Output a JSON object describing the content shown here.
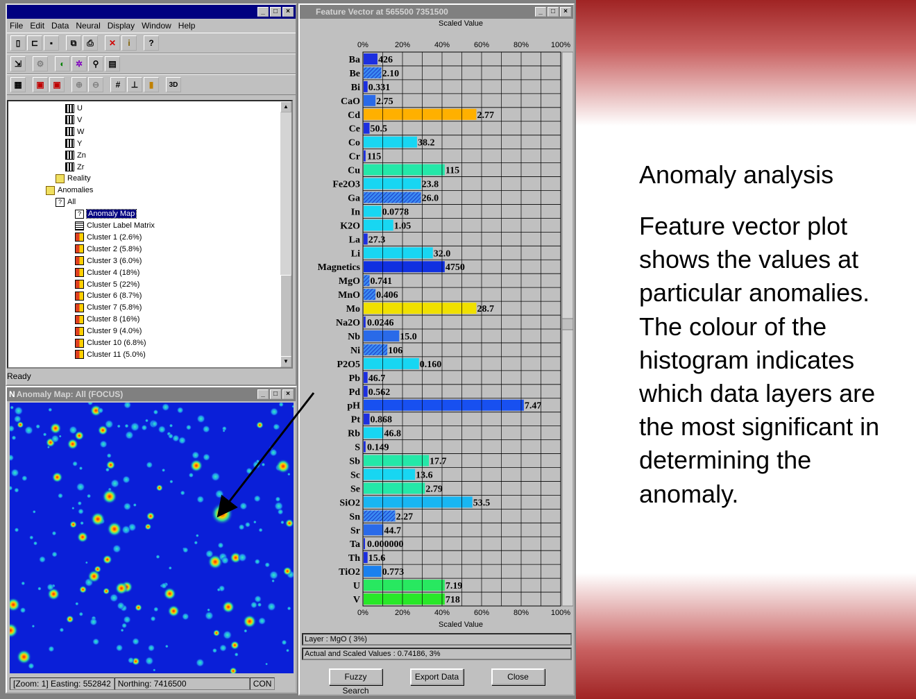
{
  "main_window": {
    "menu": [
      "File",
      "Edit",
      "Data",
      "Neural",
      "Display",
      "Window",
      "Help"
    ],
    "toolbar2_3d_label": "3D",
    "tree_items": [
      {
        "label": "U",
        "icon": "layer",
        "indent": 0
      },
      {
        "label": "V",
        "icon": "layer",
        "indent": 0
      },
      {
        "label": "W",
        "icon": "layer",
        "indent": 0
      },
      {
        "label": "Y",
        "icon": "layer",
        "indent": 0
      },
      {
        "label": "Zn",
        "icon": "layer",
        "indent": 0
      },
      {
        "label": "Zr",
        "icon": "layer",
        "indent": 0
      },
      {
        "label": "Reality",
        "icon": "folder",
        "indent": -1
      },
      {
        "label": "Anomalies",
        "icon": "folder",
        "indent": -2
      },
      {
        "label": "All",
        "icon": "doc",
        "indent": -1
      },
      {
        "label": "Anomaly Map",
        "icon": "doc",
        "indent": 1,
        "selected": true
      },
      {
        "label": "Cluster Label Matrix",
        "icon": "grid",
        "indent": 1
      },
      {
        "label": "Cluster 1 (2.6%)",
        "icon": "cluster",
        "indent": 1
      },
      {
        "label": "Cluster 2 (5.8%)",
        "icon": "cluster",
        "indent": 1
      },
      {
        "label": "Cluster 3 (6.0%)",
        "icon": "cluster",
        "indent": 1
      },
      {
        "label": "Cluster 4 (18%)",
        "icon": "cluster",
        "indent": 1
      },
      {
        "label": "Cluster 5 (22%)",
        "icon": "cluster",
        "indent": 1
      },
      {
        "label": "Cluster 6 (8.7%)",
        "icon": "cluster",
        "indent": 1
      },
      {
        "label": "Cluster 7 (5.8%)",
        "icon": "cluster",
        "indent": 1
      },
      {
        "label": "Cluster 8 (16%)",
        "icon": "cluster",
        "indent": 1
      },
      {
        "label": "Cluster 9 (4.0%)",
        "icon": "cluster",
        "indent": 1
      },
      {
        "label": "Cluster 10 (6.8%)",
        "icon": "cluster",
        "indent": 1
      },
      {
        "label": "Cluster 11 (5.0%)",
        "icon": "cluster",
        "indent": 1
      }
    ],
    "status": "Ready"
  },
  "map_window": {
    "title": "Anomaly Map: All (FOCUS)",
    "status_coords": "[Zoom: 1] Easting: 552842",
    "status_northing": "Northing: 7416500",
    "status_con": "CON"
  },
  "feature_window": {
    "title": "Feature Vector at 565500 7351500",
    "axis_title_top": "Scaled Value",
    "axis_title_bottom": "Scaled Value",
    "tick_labels": [
      "0%",
      "20%",
      "40%",
      "60%",
      "80%",
      "100%"
    ],
    "layer_field": "Layer : MgO ( 3%)",
    "values_field": "Actual and Scaled Values : 0.74186, 3%",
    "buttons": [
      "Fuzzy Search",
      "Export Data",
      "Close"
    ]
  },
  "chart_data": {
    "type": "bar",
    "orientation": "horizontal",
    "xlabel": "Scaled Value",
    "xlim": [
      0,
      100
    ],
    "categories": [
      "Ba",
      "Be",
      "Bi",
      "CaO",
      "Cd",
      "Ce",
      "Co",
      "Cr",
      "Cu",
      "Fe2O3",
      "Ga",
      "In",
      "K2O",
      "La",
      "Li",
      "Magnetics",
      "MgO",
      "MnO",
      "Mo",
      "Na2O",
      "Nb",
      "Ni",
      "P2O5",
      "Pb",
      "Pd",
      "pH",
      "Pt",
      "Rb",
      "S",
      "Sb",
      "Sc",
      "Se",
      "SiO2",
      "Sn",
      "Sr",
      "Ta",
      "Th",
      "TiO2",
      "U",
      "V"
    ],
    "labels": [
      "426",
      "2.10",
      "0.331",
      "2.75",
      "2.77",
      "50.5",
      "38.2",
      "115",
      "115",
      "23.8",
      "26.0",
      "0.0778",
      "1.05",
      "27.3",
      "32.0",
      "4750",
      "0.741",
      "0.406",
      "28.7",
      "0.0246",
      "15.0",
      "106",
      "0.160",
      "46.7",
      "0.562",
      "7.47",
      "0.868",
      "46.8",
      "0.149",
      "17.7",
      "13.6",
      "2.79",
      "53.5",
      "2.27",
      "44.7",
      "0.000000",
      "15.6",
      "0.773",
      "7.19",
      "718"
    ],
    "scaled_values": [
      7,
      9,
      2,
      6,
      57,
      3,
      27,
      1,
      41,
      29,
      29,
      9,
      15,
      2,
      35,
      41,
      3,
      6,
      57,
      1,
      18,
      12,
      28,
      2,
      2,
      81,
      3,
      10,
      1,
      33,
      26,
      31,
      55,
      16,
      10,
      0,
      2,
      9,
      41,
      41
    ],
    "colors": [
      "#1c2fe0",
      "#3858e8",
      "#1c2fe0",
      "#2a6ae8",
      "#ffb000",
      "#1c2fe0",
      "#18d6f2",
      "#1c2fe0",
      "#24e8a8",
      "#18d6f2",
      "#3ac0f0",
      "#18d6f2",
      "#18d6f2",
      "#1c2fe0",
      "#18d6f2",
      "#1030e0",
      "#3858e8",
      "#3858e8",
      "#f0e000",
      "#1c2fe0",
      "#2a6ae8",
      "#3a8af0",
      "#18d6f2",
      "#1c2fe0",
      "#1c2fe0",
      "#1850f0",
      "#1c2fe0",
      "#18d6f2",
      "#1c2fe0",
      "#24e8a8",
      "#18d6f2",
      "#24e8a8",
      "#18b6f2",
      "#3858e8",
      "#2a6ae8",
      "#1c2fe0",
      "#1c2fe0",
      "#1a80ee",
      "#28e860",
      "#28e828"
    ],
    "hatched": [
      false,
      true,
      false,
      false,
      false,
      false,
      false,
      false,
      false,
      false,
      true,
      false,
      false,
      false,
      false,
      false,
      true,
      true,
      false,
      false,
      false,
      true,
      false,
      false,
      false,
      false,
      false,
      false,
      false,
      false,
      false,
      false,
      false,
      true,
      false,
      false,
      false,
      false,
      false,
      false
    ]
  },
  "slide_text": {
    "heading": "Anomaly analysis",
    "body_lines": [
      "Feature vector plot",
      "shows the values at",
      "particular anomalies.",
      "The colour of the",
      "histogram indicates",
      "which data layers are",
      "the most significant in",
      "determining the",
      "anomaly."
    ]
  }
}
